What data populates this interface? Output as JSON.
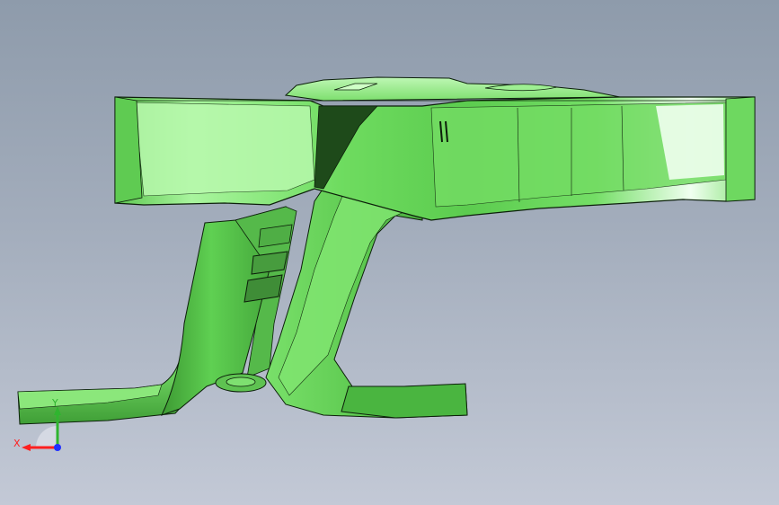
{
  "viewport": {
    "background_top": "#8e9bab",
    "background_bottom": "#c3c9d6"
  },
  "model": {
    "icon": "cad-part-3d",
    "body_color": "#66d85a",
    "highlight_color": "#e6ffe0",
    "shadow_color": "#2f7d2a",
    "edge_color": "#0c1f0a"
  },
  "triad": {
    "x_label": "X",
    "y_label": "Y",
    "x_color": "#ff2020",
    "y_color": "#2fb52f",
    "z_color": "#2030ff"
  }
}
